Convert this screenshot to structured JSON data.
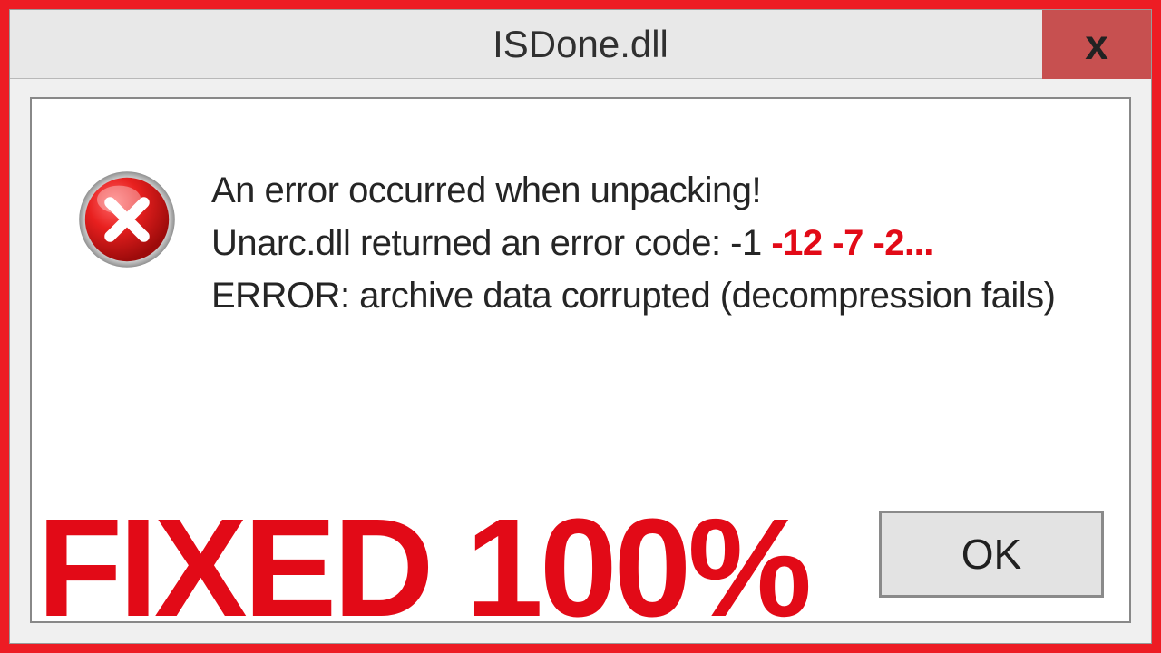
{
  "dialog": {
    "title": "ISDone.dll",
    "close_label": "x"
  },
  "message": {
    "line1": "An error occurred when unpacking!",
    "line2_prefix": "Unarc.dll returned an error code: -1 ",
    "line2_codes": "-12 -7 -2...",
    "line3": "ERROR: archive data corrupted (decompression fails)"
  },
  "overlay": {
    "fixed_text": "FIXED 100%"
  },
  "buttons": {
    "ok_label": "OK"
  }
}
